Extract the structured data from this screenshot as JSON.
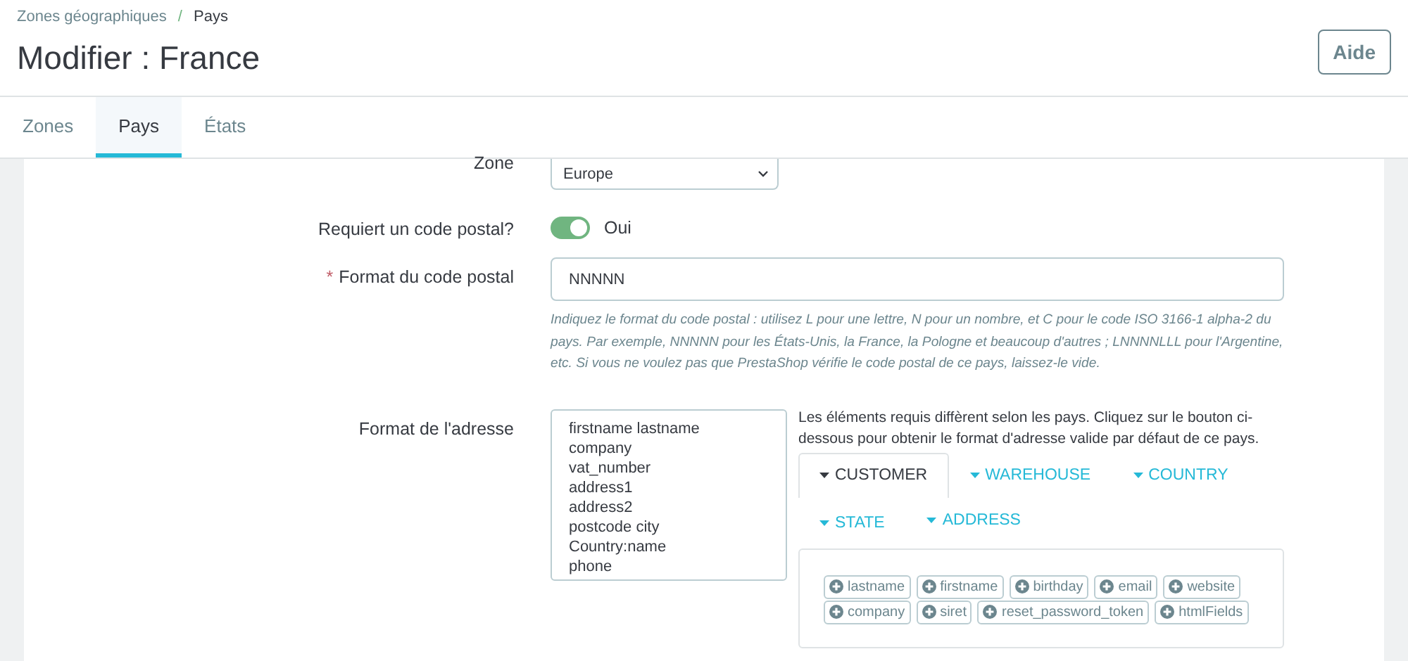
{
  "breadcrumb": {
    "items": [
      {
        "label": "Zones géographiques"
      },
      {
        "label": "Pays"
      }
    ],
    "separator": "/"
  },
  "title": "Modifier : France",
  "help_button": "Aide",
  "tabs": [
    {
      "label": "Zones",
      "selected": false
    },
    {
      "label": "Pays",
      "selected": true
    },
    {
      "label": "États",
      "selected": false
    }
  ],
  "form": {
    "zone": {
      "label": "Zone",
      "value": "Europe"
    },
    "postcode_required": {
      "label": "Requiert un code postal?",
      "on": true,
      "value_label": "Oui"
    },
    "postcode_format": {
      "label": "Format du code postal",
      "required": true,
      "required_mark": "*",
      "value": "NNNNN",
      "help": "Indiquez le format du code postal : utilisez L pour une lettre, N pour un nombre, et C pour le code ISO 3166-1 alpha-2 du pays. Par exemple, NNNNN pour les États-Unis, la France, la Pologne et beaucoup d'autres ; LNNNNLLL pour l'Argentine, etc. Si vous ne voulez pas que PrestaShop vérifie le code postal de ce pays, laissez-le vide."
    },
    "address_format": {
      "label": "Format de l'adresse",
      "lines": [
        "firstname lastname",
        "company",
        "vat_number",
        "address1",
        "address2",
        "postcode city",
        "Country:name",
        "phone"
      ],
      "help": "Les éléments requis diffèrent selon les pays. Cliquez sur le bouton ci-dessous pour obtenir le format d'adresse valide par défaut de ce pays.",
      "tabs": [
        {
          "label": "CUSTOMER",
          "selected": true
        },
        {
          "label": "WAREHOUSE",
          "selected": false
        },
        {
          "label": "COUNTRY",
          "selected": false
        },
        {
          "label": "STATE",
          "selected": false
        },
        {
          "label": "ADDRESS",
          "selected": false
        }
      ],
      "fields": [
        "lastname",
        "firstname",
        "birthday",
        "email",
        "website",
        "company",
        "siret",
        "reset_password_token",
        "htmlFields"
      ]
    }
  }
}
